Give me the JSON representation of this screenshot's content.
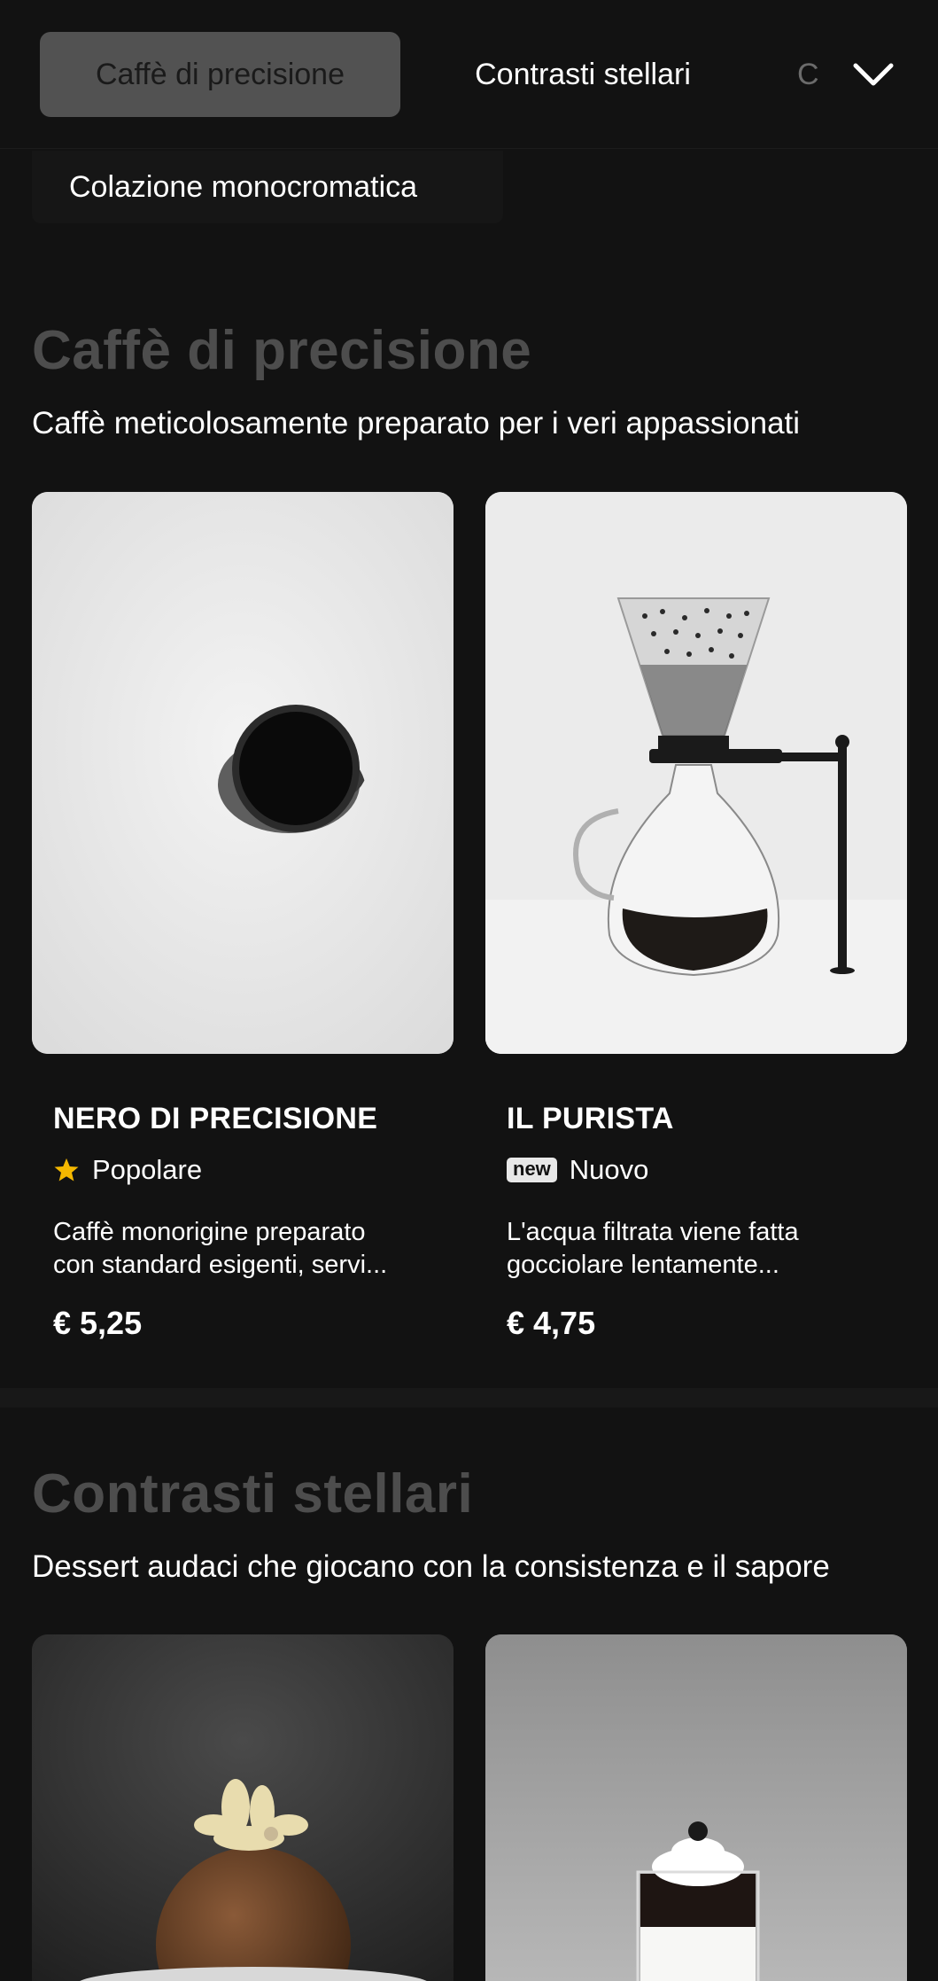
{
  "nav": {
    "tabs": [
      {
        "label": "Caffè di precisione",
        "active": true
      },
      {
        "label": "Contrasti stellari",
        "active": false
      },
      {
        "label": "C",
        "active": false
      },
      {
        "label": "Colazione monocromatica",
        "active": false
      }
    ],
    "expand_icon": "chevron-down-icon"
  },
  "sections": [
    {
      "title": "Caffè di precisione",
      "subtitle": "Caffè meticolosamente preparato per i veri appassionati",
      "items": [
        {
          "name": "NERO DI PRECISIONE",
          "badge_icon": "star-icon",
          "badge": "Popolare",
          "description_line1": "Caffè monorigine preparato",
          "description_line2": "con standard esigenti, servi...",
          "price": "€ 5,25",
          "image": "black coffee cup on white"
        },
        {
          "name": "IL PURISTA",
          "badge_icon_text": "new",
          "badge": "Nuovo",
          "description_line1": "L'acqua filtrata viene fatta",
          "description_line2": "gocciolare lentamente...",
          "price": "€ 4,75",
          "image": "pour-over coffee maker"
        }
      ]
    },
    {
      "title": "Contrasti stellari",
      "subtitle": "Dessert audaci che giocano con la consistenza e il sapore",
      "items": [
        {
          "image": "chocolate dome dessert"
        },
        {
          "image": "layered cream dessert cup"
        }
      ]
    }
  ],
  "colors": {
    "background": "#121212",
    "active_tab": "#525252",
    "section_title": "#4d4d4d",
    "star": "#f5b800"
  }
}
